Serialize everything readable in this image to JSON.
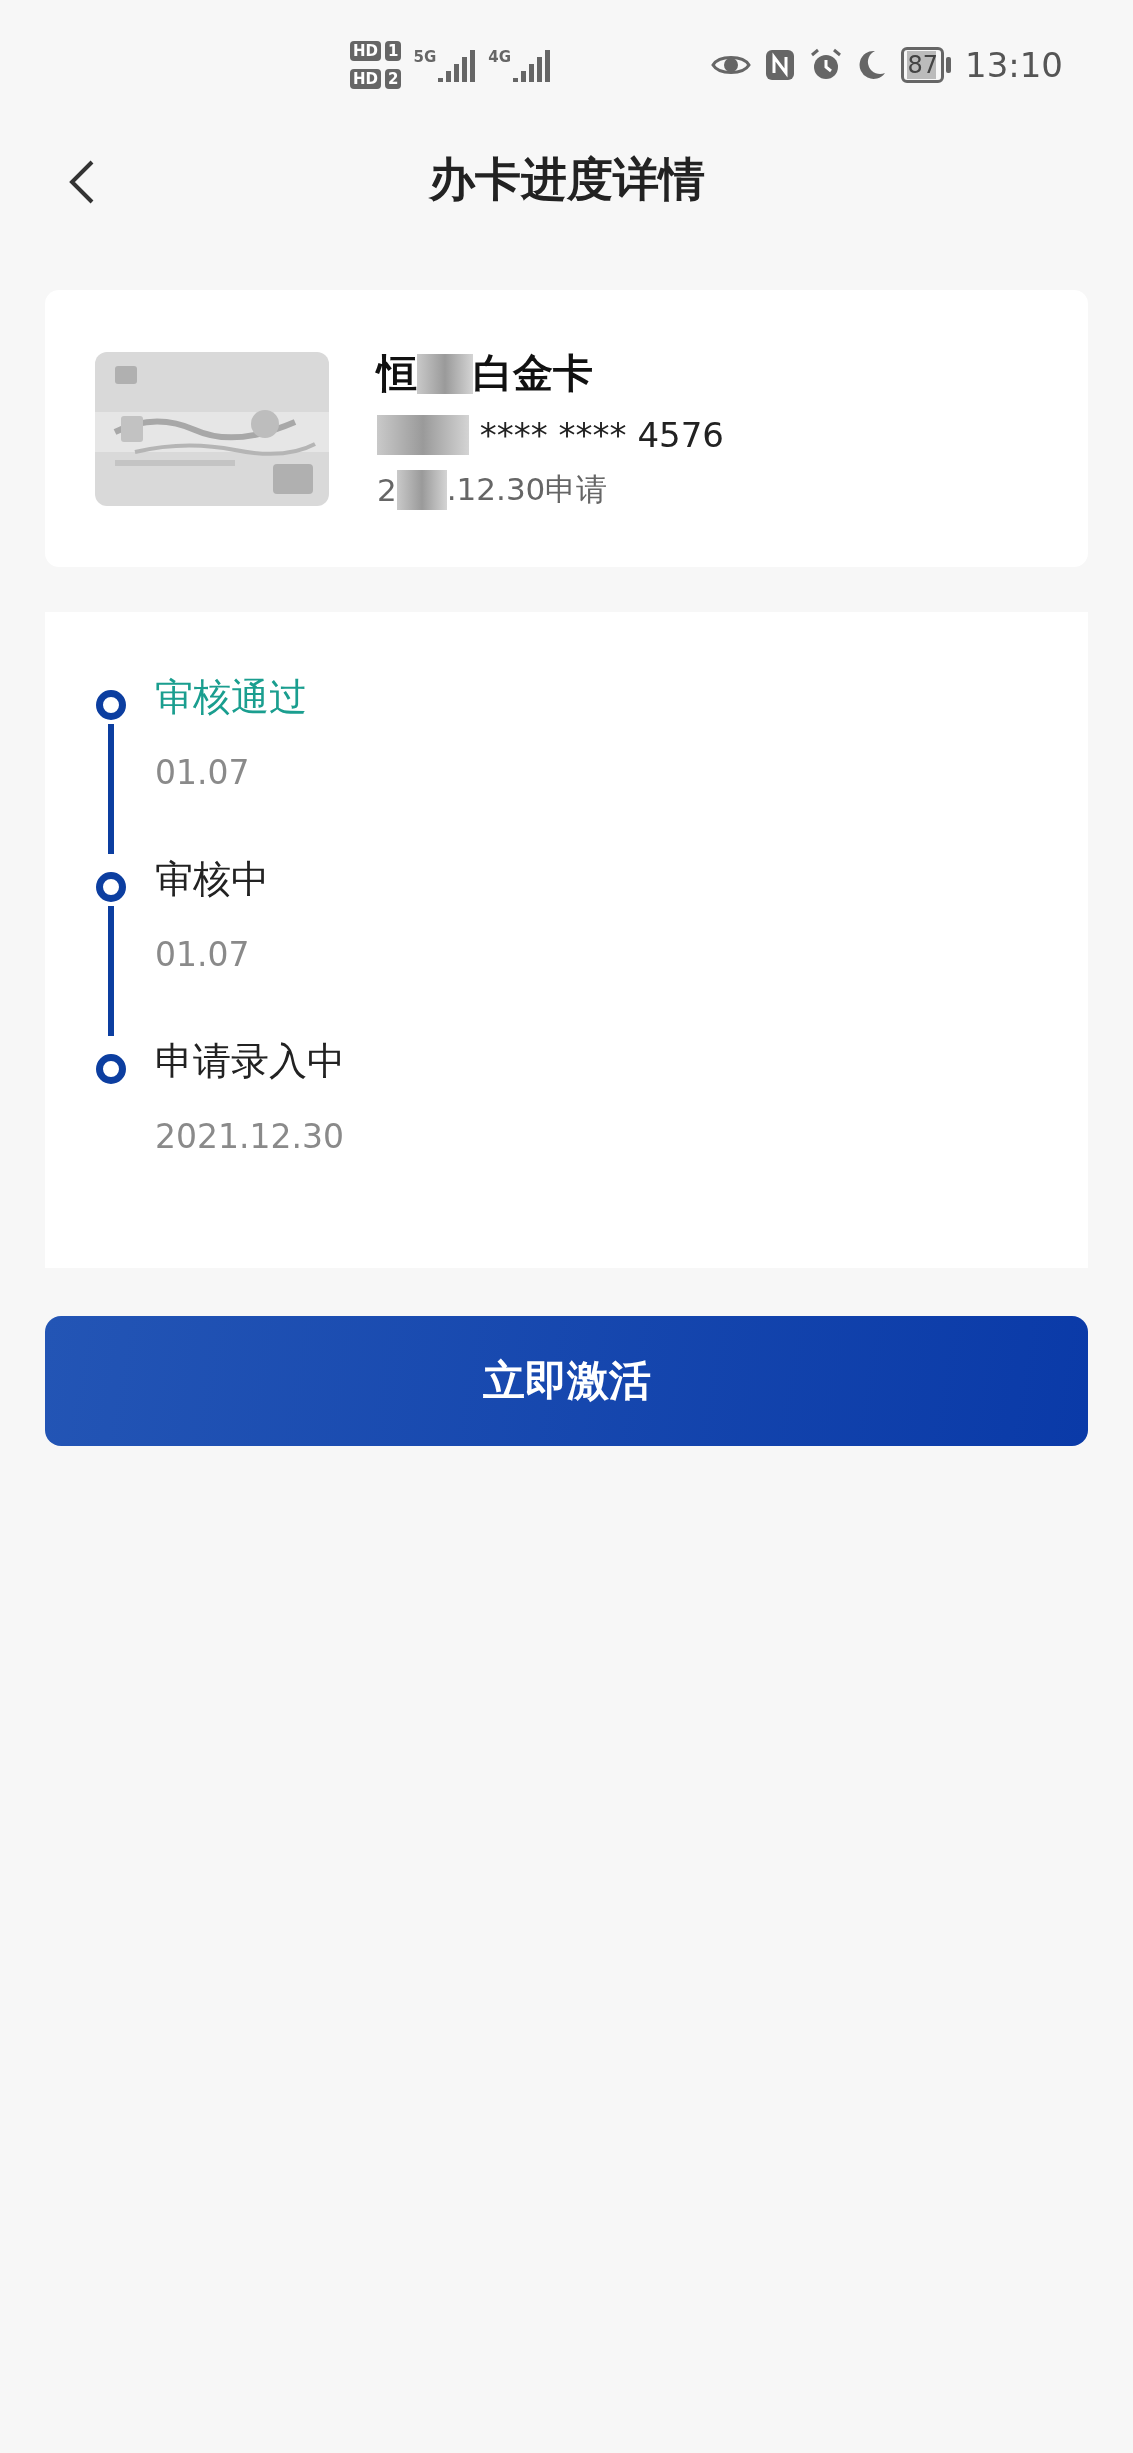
{
  "status_bar": {
    "sims": [
      {
        "label": "HD",
        "slot": "1"
      },
      {
        "label": "HD",
        "slot": "2"
      }
    ],
    "networks": [
      "5G",
      "4G"
    ],
    "battery": "87",
    "time": "13:10"
  },
  "header": {
    "title": "办卡进度详情"
  },
  "card": {
    "name_start": "恒",
    "name_end": "白金卡",
    "number": "**** **** 4576",
    "date_start": "2",
    "date_end": ".12.30申请"
  },
  "timeline": [
    {
      "status": "审核通过",
      "date": "01.07",
      "current": true
    },
    {
      "status": "审核中",
      "date": "01.07",
      "current": false
    },
    {
      "status": "申请录入中",
      "date": "2021.12.30",
      "current": false
    }
  ],
  "action_button": "立即激活"
}
